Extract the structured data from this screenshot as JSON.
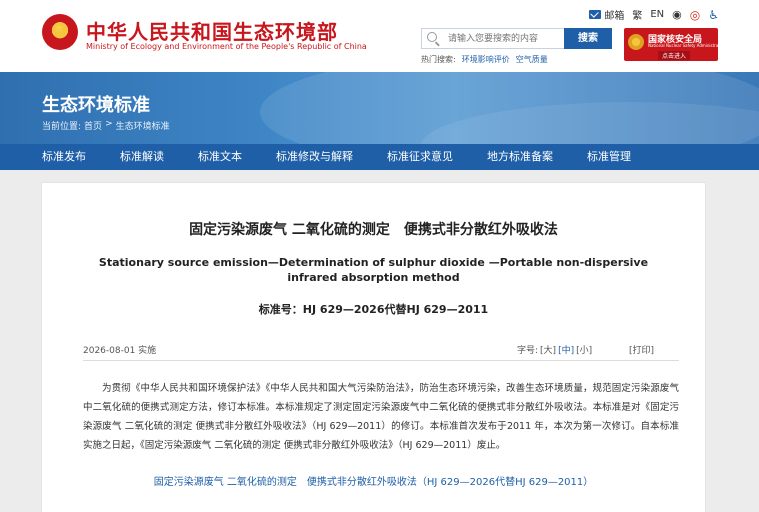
{
  "header": {
    "ministry_cn": "中华人民共和国生态环境部",
    "ministry_en": "Ministry of Ecology and Environment of the People's Republic of China",
    "toplinks": {
      "mail": "邮箱",
      "trad": "繁",
      "en": "EN"
    },
    "search": {
      "placeholder": "请输入您要搜索的内容",
      "button": "搜索"
    },
    "hot": {
      "label": "热门搜索:",
      "items": [
        "环境影响评价",
        "空气质量"
      ]
    },
    "nnsa": {
      "cn": "国家核安全局",
      "en": "National Nuclear Safety Administration",
      "go": "点击进入"
    }
  },
  "banner": {
    "title": "生态环境标准",
    "crumb_label": "当前位置:",
    "crumb_home": "首页",
    "crumb_sep": ">",
    "crumb_current": "生态环境标准"
  },
  "nav": [
    "标准发布",
    "标准解读",
    "标准文本",
    "标准修改与解释",
    "标准征求意见",
    "地方标准备案",
    "标准管理"
  ],
  "article": {
    "title_cn": "固定污染源废气 二氧化硫的测定　便携式非分散红外吸收法",
    "title_en": "Stationary source emission—Determination of sulphur dioxide —Portable non-dispersive infrared absorption method",
    "standard_no": "标准号：HJ 629—2026代替HJ 629—2011",
    "date": "2026-08-01 实施",
    "font_size": {
      "label": "字号:",
      "large": "[大]",
      "medium": "[中]",
      "small": "[小]"
    },
    "print": "[打印]",
    "body": "为贯彻《中华人民共和国环境保护法》《中华人民共和国大气污染防治法》，防治生态环境污染，改善生态环境质量，规范固定污染源废气中二氧化硫的便携式测定方法，修订本标准。本标准规定了测定固定污染源废气中二氧化硫的便携式非分散红外吸收法。本标准是对《固定污染源废气 二氧化硫的测定 便携式非分散红外吸收法》（HJ 629—2011）的修订。本标准首次发布于2011 年，本次为第一次修订。自本标准实施之日起，《固定污染源废气 二氧化硫的测定 便携式非分散红外吸收法》（HJ 629—2011）废止。",
    "attachment": "固定污染源废气 二氧化硫的测定　便携式非分散红外吸收法（HJ 629—2026代替HJ 629—2011）"
  },
  "colors": {
    "brand_red": "#c8161d",
    "nav_blue": "#1f5fa8",
    "banner_blue": "#3f86c6"
  }
}
